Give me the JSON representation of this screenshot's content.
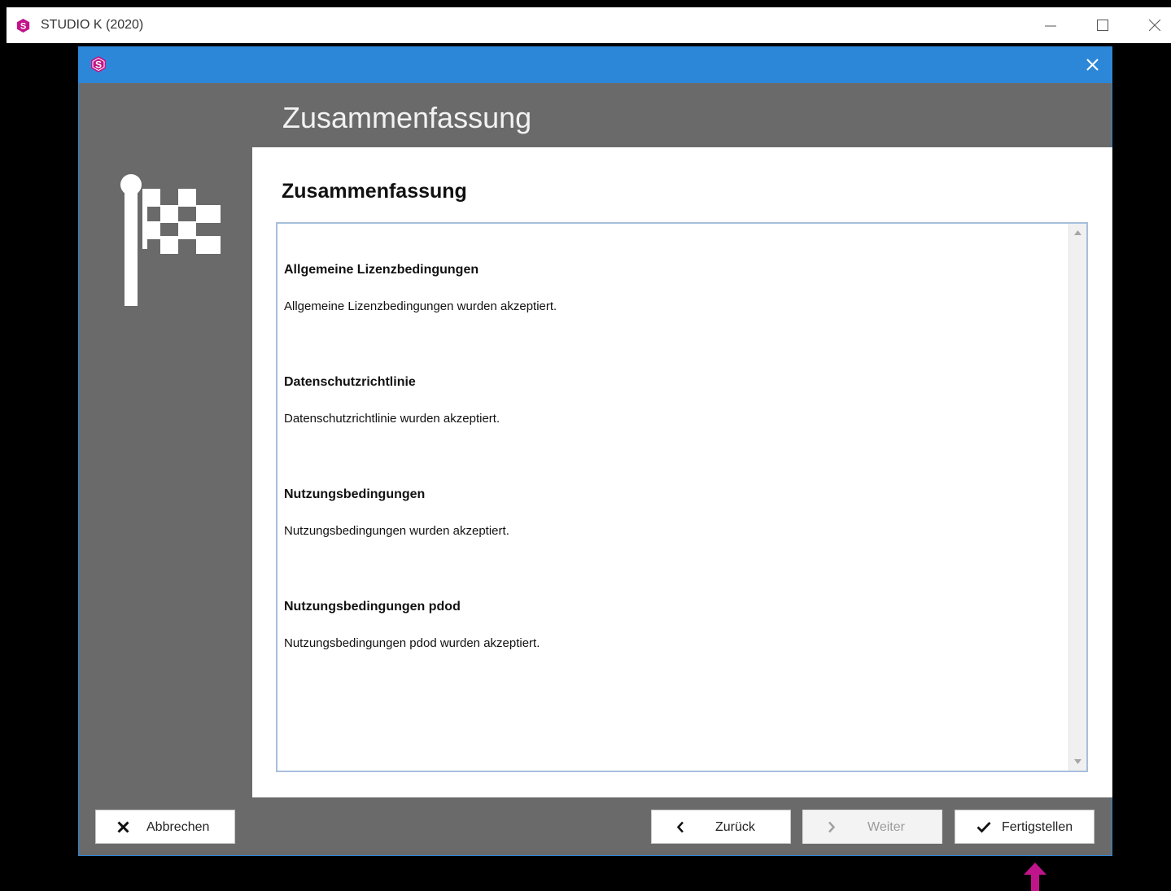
{
  "app": {
    "title": "STUDIO K (2020)",
    "brand_color": "#c0158a"
  },
  "dialog": {
    "header_title": "Zusammenfassung",
    "title_bar_color": "#2d87d9",
    "icon": "checkered-flag-icon"
  },
  "content": {
    "heading": "Zusammenfassung",
    "sections": [
      {
        "title": "Allgemeine Lizenzbedingungen",
        "text": "Allgemeine Lizenzbedingungen wurden akzeptiert."
      },
      {
        "title": "Datenschutzrichtlinie",
        "text": "Datenschutzrichtlinie wurden akzeptiert."
      },
      {
        "title": "Nutzungsbedingungen",
        "text": "Nutzungsbedingungen wurden akzeptiert."
      },
      {
        "title": "Nutzungsbedingungen pdod",
        "text": "Nutzungsbedingungen pdod wurden akzeptiert."
      }
    ]
  },
  "buttons": {
    "cancel": "Abbrechen",
    "back": "Zurück",
    "next": "Weiter",
    "finish": "Fertigstellen"
  },
  "annotation": {
    "arrow_color": "#c0158a"
  }
}
